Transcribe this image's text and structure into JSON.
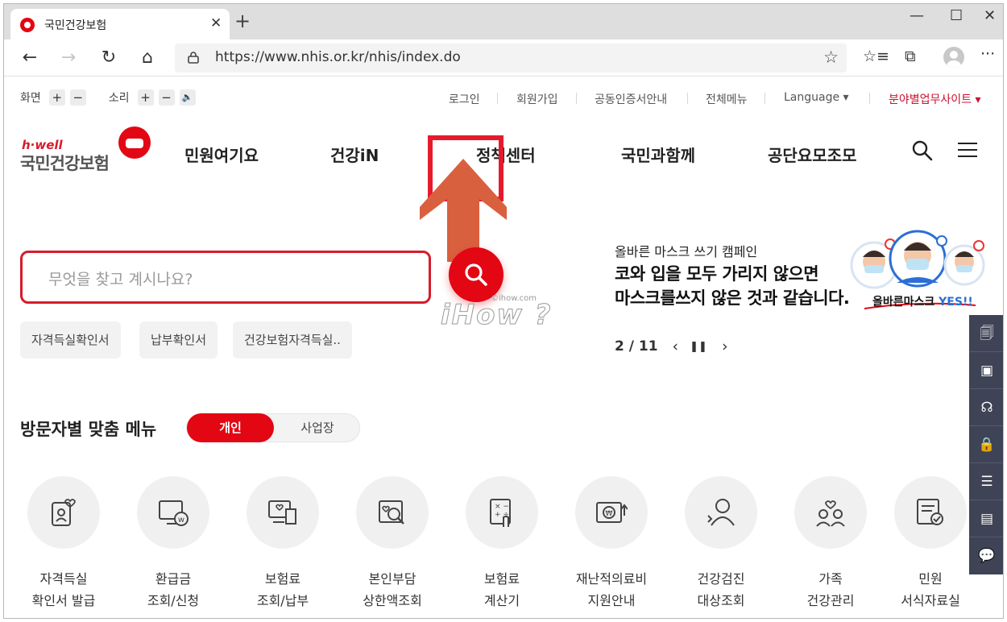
{
  "browser": {
    "tab_title": "국민건강보험",
    "tab_close": "✕",
    "new_tab": "+",
    "url": "https://www.nhis.or.kr/nhis/index.do",
    "window_controls": {
      "minimize": "—",
      "maximize": "☐",
      "close": "✕"
    },
    "nav": {
      "back": "←",
      "forward": "→",
      "reload": "↻",
      "home": "⌂"
    },
    "toolbar": {
      "favorites": "☆",
      "favorites_bar": "☆≡",
      "collections": "⧉",
      "more": "···"
    }
  },
  "utility": {
    "screen_label": "화면",
    "sound_label": "소리",
    "plus": "+",
    "minus": "−",
    "speaker": "🔈",
    "login": "로그인",
    "signup": "회원가입",
    "cert": "공동인증서안내",
    "all_menu": "전체메뉴",
    "language": "Language ▾",
    "business_sites": "분야별업무사이트 ▾"
  },
  "logo": {
    "hwell": "h·well",
    "name": "국민건강보험"
  },
  "gnb": [
    "민원여기요",
    "건강iN",
    "정책센터",
    "국민과함께",
    "공단요모조모"
  ],
  "search": {
    "placeholder": "무엇을 찾고 계시나요?"
  },
  "watermark": {
    "main": "iHow ?",
    "small": "©ihow.com"
  },
  "quick_links": [
    "자격득실확인서",
    "납부확인서",
    "건강보험자격득실.."
  ],
  "banner": {
    "subtitle": "올바른 마스크 쓰기 캠페인",
    "line1": "코와 입을 모두 가리지 않으면",
    "line2": "마스크를쓰지 않은 것과 같습니다.",
    "caption_main": "올바른마스크 ",
    "caption_yes": "YES!!",
    "slide": "2 / 11",
    "prev": "‹",
    "pause": "❚❚",
    "next": "›"
  },
  "visitor_menu": {
    "title": "방문자별 맞춤 메뉴",
    "tab_personal": "개인",
    "tab_business": "사업장"
  },
  "services": [
    {
      "line1": "자격득실",
      "line2": "확인서 발급"
    },
    {
      "line1": "환급금",
      "line2": "조회/신청"
    },
    {
      "line1": "보험료",
      "line2": "조회/납부"
    },
    {
      "line1": "본인부담",
      "line2": "상한액조회"
    },
    {
      "line1": "보험료",
      "line2": "계산기"
    },
    {
      "line1": "재난적의료비",
      "line2": "지원안내"
    },
    {
      "line1": "건강검진",
      "line2": "대상조회"
    },
    {
      "line1": "가족",
      "line2": "건강관리"
    },
    {
      "line1": "민원",
      "line2": "서식자료실"
    }
  ],
  "colors": {
    "brand_red": "#e30613",
    "highlight_red": "#e51b2b",
    "dock_bg": "#3e4356",
    "arrow_orange": "#d9603e"
  }
}
